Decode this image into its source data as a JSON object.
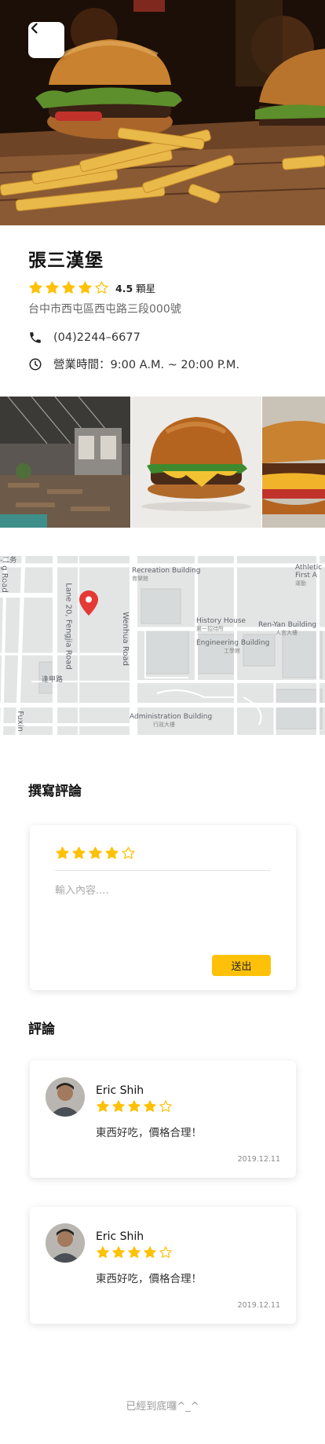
{
  "restaurant": {
    "name": "張三漢堡",
    "rating_value": "4.5",
    "rating_unit": " 顆星",
    "rating_stars": 4,
    "address": "台中市西屯區西屯路三段000號",
    "phone": "(04)2244–6677",
    "hours": "營業時間：9:00 A.M. ~ 20:00 P.M."
  },
  "icons": {
    "back": "chevron-left-icon",
    "phone": "phone-icon",
    "clock": "clock-icon",
    "star_full": "star-icon",
    "star_empty": "star-outline-icon",
    "map_pin": "map-pin-icon"
  },
  "colors": {
    "accent": "#ffc107",
    "map_pin": "#e53935"
  },
  "map": {
    "labels": {
      "recreation": "Recreation Building",
      "recreation_zh": "育樂館",
      "athletic": "Athletic",
      "first": "First A",
      "first_zh": "運動",
      "history": "History House",
      "history_zh": "第一招待所",
      "renyan": "Ren-Yan Building",
      "renyan_zh": "人言大樓",
      "engineering": "Engineering Building",
      "engineering_zh": "工學館",
      "lane20": "Lane 20, Fengjia Road",
      "wenhua": "Wenhua Road",
      "road_left": "g Road",
      "fuxin": "Fuxin",
      "fengjia_zh": "逢甲路",
      "admin": "Administration Building",
      "admin_zh": "行政大樓",
      "corner": "-二务"
    }
  },
  "write_review": {
    "title": "撰寫評論",
    "stars": 4,
    "placeholder": "輸入內容....",
    "submit_label": "送出"
  },
  "reviews_section": {
    "title": "評論",
    "items": [
      {
        "name": "Eric Shih",
        "stars": 4,
        "text": "東西好吃，價格合理！",
        "date": "2019.12.11"
      },
      {
        "name": "Eric Shih",
        "stars": 4,
        "text": "東西好吃，價格合理！",
        "date": "2019.12.11"
      }
    ]
  },
  "footer": {
    "end_text": "已經到底囉^_^"
  }
}
